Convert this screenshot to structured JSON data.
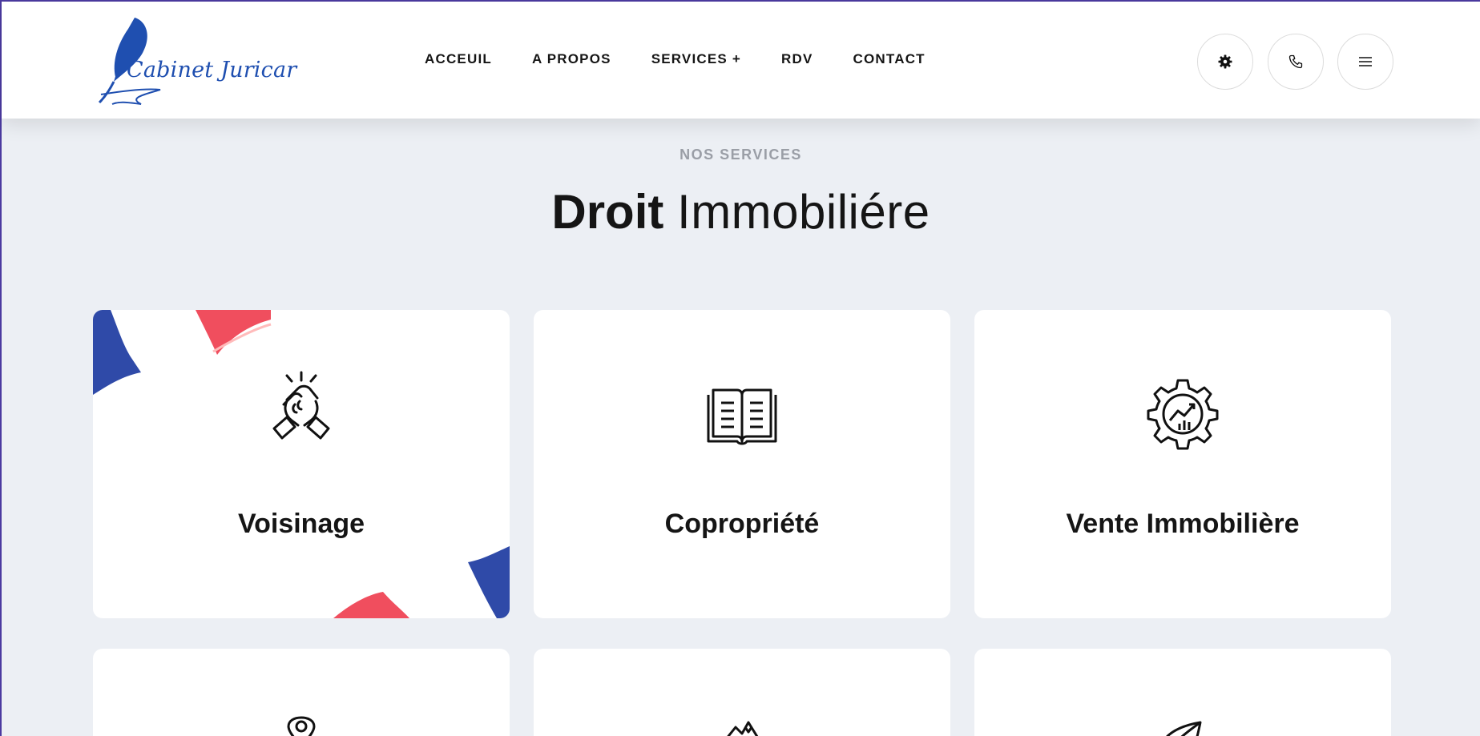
{
  "header": {
    "logo_text": "Cabinet Juricar",
    "nav": [
      "ACCEUIL",
      "A PROPOS",
      "SERVICES +",
      "RDV",
      "CONTACT"
    ],
    "icons": [
      "settings-icon",
      "phone-icon",
      "menu-icon"
    ]
  },
  "section": {
    "subtitle": "NOS SERVICES",
    "title_bold": "Droit",
    "title_light": "Immobiliére"
  },
  "cards": [
    {
      "title": "Voisinage",
      "icon": "handshake-icon"
    },
    {
      "title": "Copropriété",
      "icon": "open-book-icon"
    },
    {
      "title": "Vente Immobilière",
      "icon": "gear-chart-icon"
    },
    {
      "title": "",
      "icon": "location-pin-icon"
    },
    {
      "title": "",
      "icon": "mountain-icon"
    },
    {
      "title": "",
      "icon": "leaf-icon"
    }
  ],
  "colors": {
    "background": "#eceff4",
    "accent_blue": "#2f4aa8",
    "accent_red": "#f04e5e",
    "logo_blue": "#1f4fb0"
  }
}
